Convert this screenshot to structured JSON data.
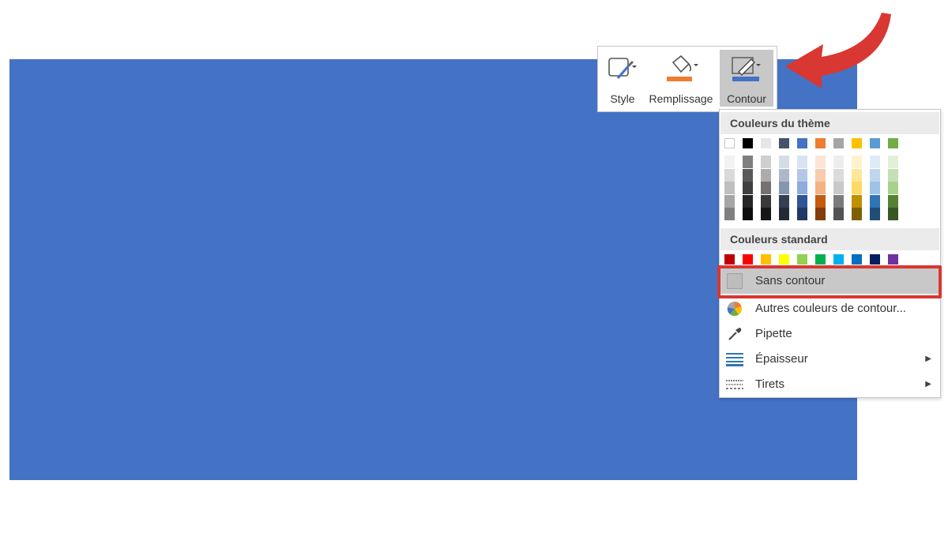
{
  "toolbar": {
    "style_label": "Style",
    "fill_label": "Remplissage",
    "outline_label": "Contour"
  },
  "colors": {
    "shape_fill": "#4472c4",
    "fill_accent": "#ed7d31",
    "outline_accent": "#4472c4",
    "highlight_border": "#d93731",
    "arrow": "#d93731"
  },
  "dropdown": {
    "theme_header": "Couleurs du thème",
    "standard_header": "Couleurs standard",
    "theme_top_row": [
      "#ffffff",
      "#000000",
      "#e7e6e6",
      "#44546a",
      "#4472c4",
      "#ed7d31",
      "#a5a5a5",
      "#ffc000",
      "#5b9bd5",
      "#70ad47"
    ],
    "theme_shades": [
      [
        "#f2f2f2",
        "#d9d9d9",
        "#bfbfbf",
        "#a6a6a6",
        "#808080"
      ],
      [
        "#7f7f7f",
        "#595959",
        "#404040",
        "#262626",
        "#0d0d0d"
      ],
      [
        "#d0cece",
        "#aeabab",
        "#757171",
        "#3a3838",
        "#171616"
      ],
      [
        "#d6dce5",
        "#adb9ca",
        "#8497b0",
        "#333f50",
        "#222a35"
      ],
      [
        "#dae3f3",
        "#b4c7e7",
        "#8faadc",
        "#2f5597",
        "#203864"
      ],
      [
        "#fbe5d6",
        "#f8cbad",
        "#f4b183",
        "#c55a11",
        "#843c0c"
      ],
      [
        "#ededed",
        "#dbdbdb",
        "#c9c9c9",
        "#7b7b7b",
        "#525252"
      ],
      [
        "#fff2cc",
        "#ffe699",
        "#ffd966",
        "#bf9000",
        "#7f6000"
      ],
      [
        "#deebf7",
        "#bdd7ee",
        "#9dc3e6",
        "#2e75b6",
        "#1f4e79"
      ],
      [
        "#e2f0d9",
        "#c5e0b4",
        "#a9d18e",
        "#548235",
        "#385723"
      ]
    ],
    "standard_colors": [
      "#c00000",
      "#ff0000",
      "#ffc000",
      "#ffff00",
      "#92d050",
      "#00b050",
      "#00b0f0",
      "#0070c0",
      "#002060",
      "#7030a0"
    ],
    "items": {
      "no_outline": "Sans contour",
      "more_colors": "Autres couleurs de contour...",
      "eyedropper": "Pipette",
      "weight": "Épaisseur",
      "dashes": "Tirets"
    }
  },
  "icons": {
    "style": "shape-style-icon",
    "fill": "paint-bucket-icon",
    "outline": "pencil-outline-icon",
    "more_colors": "color-wheel-icon",
    "eyedropper": "eyedropper-icon",
    "weight": "line-weight-icon",
    "dashes": "dashes-icon",
    "submenu": "chevron-right-icon"
  }
}
